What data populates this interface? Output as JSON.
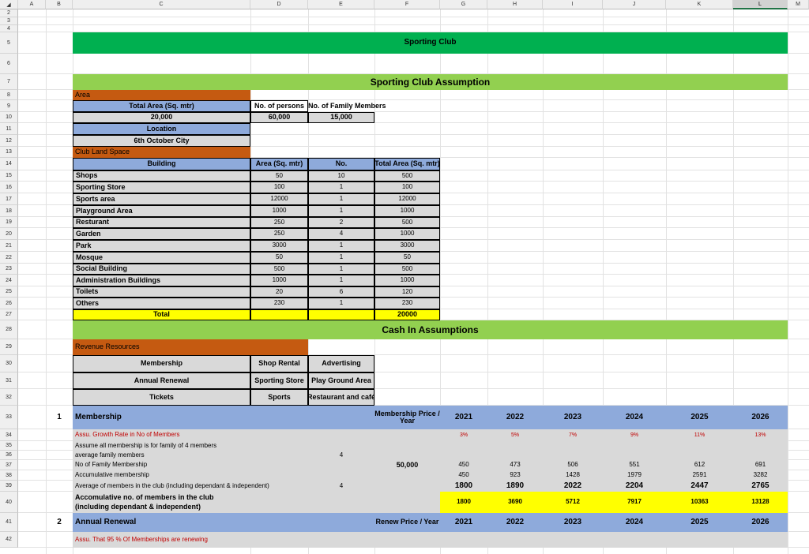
{
  "columns": [
    "A",
    "B",
    "C",
    "D",
    "E",
    "F",
    "G",
    "H",
    "I",
    "J",
    "K",
    "L",
    "M"
  ],
  "selected_column": "L",
  "rows": [
    "2",
    "3",
    "4",
    "5",
    "6",
    "7",
    "8",
    "9",
    "10",
    "11",
    "12",
    "13",
    "14",
    "15",
    "16",
    "17",
    "18",
    "19",
    "20",
    "21",
    "22",
    "23",
    "24",
    "25",
    "26",
    "27",
    "28",
    "29",
    "30",
    "31",
    "32",
    "33",
    "34",
    "35",
    "36",
    "37",
    "38",
    "39",
    "40",
    "41",
    "42"
  ],
  "colors": {
    "green_dark": "#00b050",
    "green_light": "#92d050",
    "orange": "#c55a11",
    "blue": "#8eaadb",
    "gray": "#d9d9d9",
    "yellow": "#ffff00"
  },
  "title": "Sporting Club",
  "assumption_title": "Sporting Club Assumption",
  "area": {
    "section_label": "Area",
    "total_area_header": "Total Area (Sq. mtr)",
    "persons_header": "No. of persons",
    "family_header": "No. of Family Members",
    "total_area_value": "20,000",
    "persons_value": "60,000",
    "family_value": "15,000",
    "location_header": "Location",
    "location_value": "6th October City"
  },
  "land": {
    "section_label": "Club Land Space",
    "headers": [
      "Building",
      "Area (Sq. mtr)",
      "No.",
      "Total Area (Sq. mtr)"
    ],
    "rows": [
      [
        "Shops",
        "50",
        "10",
        "500"
      ],
      [
        "Sporting Store",
        "100",
        "1",
        "100"
      ],
      [
        "Sports area",
        "12000",
        "1",
        "12000"
      ],
      [
        "Playground  Area",
        "1000",
        "1",
        "1000"
      ],
      [
        "Resturant",
        "250",
        "2",
        "500"
      ],
      [
        "Garden",
        "250",
        "4",
        "1000"
      ],
      [
        "Park",
        "3000",
        "1",
        "3000"
      ],
      [
        "Mosque",
        "50",
        "1",
        "50"
      ],
      [
        "Social Building",
        "500",
        "1",
        "500"
      ],
      [
        "Administration Buildings",
        "1000",
        "1",
        "1000"
      ],
      [
        "Toilets",
        "20",
        "6",
        "120"
      ],
      [
        "Others",
        "230",
        "1",
        "230"
      ]
    ],
    "total_label": "Total",
    "total_value": "20000"
  },
  "cash_title": "Cash In Assumptions",
  "revenue": {
    "section_label": "Revenue Resources",
    "rows": [
      [
        "Membership",
        "Shop Rental",
        "Advertising"
      ],
      [
        "Annual Renewal",
        "Sporting Store",
        "Play Ground Area"
      ],
      [
        "Tickets",
        "Sports",
        "Restaurant and café"
      ]
    ]
  },
  "membership": {
    "num": "1",
    "title": "Membership",
    "price_header": "Membership Price / Year",
    "years": [
      "2021",
      "2022",
      "2023",
      "2024",
      "2025",
      "2026"
    ],
    "growth_label": "Assu. Growth Rate in No of Members",
    "growth": [
      "3%",
      "5%",
      "7%",
      "9%",
      "11%",
      "13%"
    ],
    "assume_label": "Assume all membership is for family of 4 members",
    "avg_family_label": "average family members",
    "avg_family_value": "4",
    "family_membership_label": "No of Family Membership",
    "price_value": "50,000",
    "family_membership": [
      "450",
      "473",
      "506",
      "551",
      "612",
      "691"
    ],
    "accum_label": "Accumulative membership",
    "accum": [
      "450",
      "923",
      "1428",
      "1979",
      "2591",
      "3282"
    ],
    "avg_members_label": "Average of members in the club (including dependant & independent)",
    "avg_members_factor": "4",
    "avg_members": [
      "1800",
      "1890",
      "2022",
      "2204",
      "2447",
      "2765"
    ],
    "accum_total_label_1": "Accomulative no. of members in the club",
    "accum_total_label_2": "(including dependant & independent)",
    "accum_total": [
      "1800",
      "3690",
      "5712",
      "7917",
      "10363",
      "13128"
    ]
  },
  "renewal": {
    "num": "2",
    "title": "Annual Renewal",
    "price_header": "Renew  Price / Year",
    "years": [
      "2021",
      "2022",
      "2023",
      "2024",
      "2025",
      "2026"
    ],
    "note": "Assu. That 95 % Of Memberships are renewing"
  }
}
